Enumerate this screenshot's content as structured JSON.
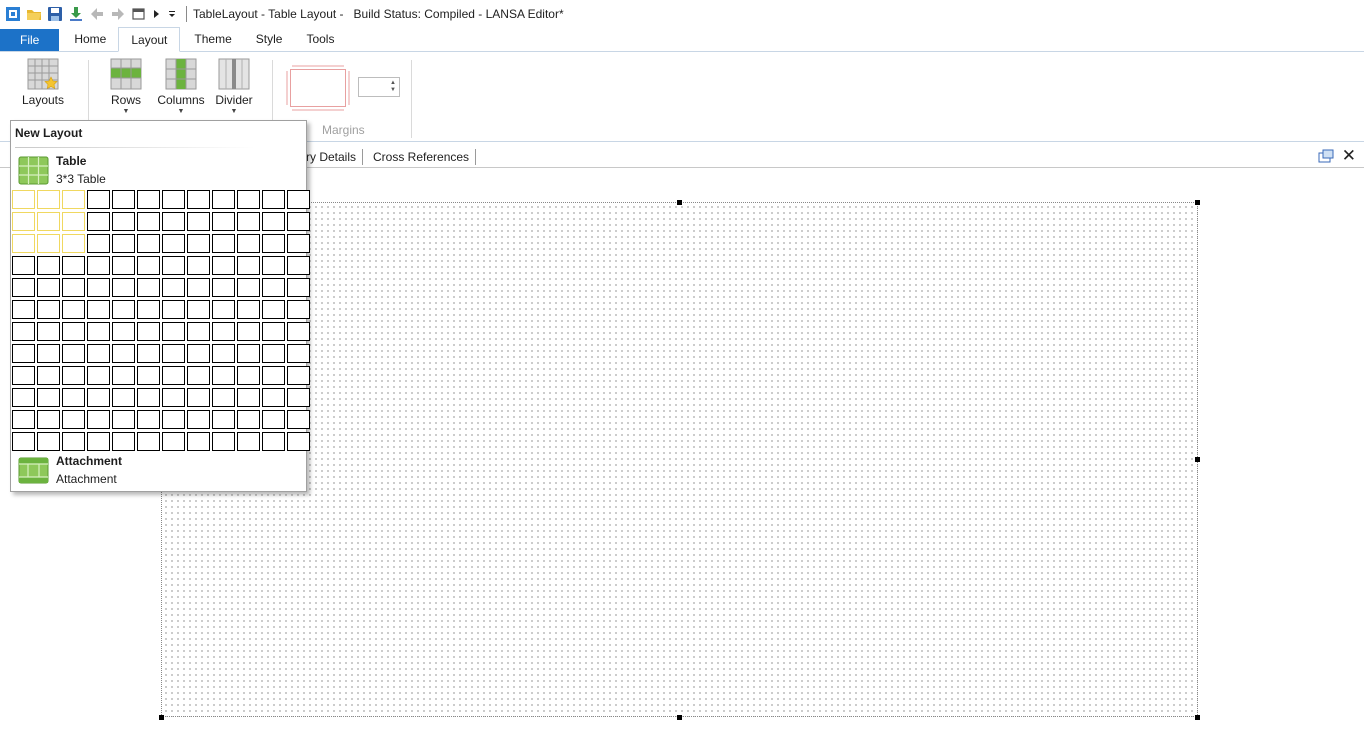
{
  "titlebar": {
    "title": "TableLayout - Table Layout -   Build Status: Compiled - LANSA Editor*",
    "icons": [
      "app-icon",
      "open-folder-icon",
      "save-icon",
      "download-icon",
      "back-icon",
      "forward-icon",
      "window-icon",
      "play-icon",
      "customize-icon"
    ]
  },
  "ribbon_tabs": [
    "File",
    "Home",
    "Layout",
    "Theme",
    "Style",
    "Tools"
  ],
  "active_tab": "Layout",
  "ribbon": {
    "layouts_label": "Layouts",
    "rows_label": "Rows",
    "columns_label": "Columns",
    "divider_label": "Divider",
    "margins_group_label": "Margins",
    "margin_value": ""
  },
  "doc_tabs": {
    "visible_partial": "ry Details",
    "cross_references": "Cross References"
  },
  "dropdown": {
    "header": "New Layout",
    "table_title": "Table",
    "table_sub": "3*3 Table",
    "grid_rows": 12,
    "grid_cols": 12,
    "selected_rows": 3,
    "selected_cols": 3,
    "attachment_title": "Attachment",
    "attachment_sub": "Attachment"
  },
  "colors": {
    "file_tab": "#1c72c8",
    "selection": "#f0d860",
    "green_icon": "#6cb33f"
  }
}
